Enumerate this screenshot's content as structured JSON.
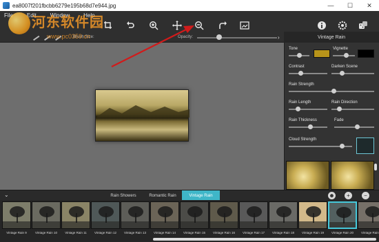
{
  "window": {
    "title": "ea8007f201fbcbb6279e195b68d7e944.jpg",
    "controls": [
      "—",
      "☐",
      "✕"
    ]
  },
  "menu": {
    "items": [
      "File",
      "Edit",
      "Window",
      "Help"
    ]
  },
  "toolbar": {
    "left_icons": [
      "open-icon",
      "save-icon",
      "crop-icon",
      "undo-icon"
    ],
    "center_icons": [
      "zoom-in-icon",
      "move-icon",
      "zoom-out-icon",
      "redo-icon",
      "fit-screen-icon"
    ],
    "right_icons": [
      "info-icon",
      "settings-icon",
      "random-icon"
    ]
  },
  "brush_bar": {
    "brush_size_label": "Brush Size:",
    "opacity_label": "Opacity:"
  },
  "panel": {
    "title": "Vintage Rain",
    "expand_arrow": "›",
    "controls": {
      "tone": "Tone",
      "vignette": "Vignette",
      "contrast": "Contrast",
      "darken_scene": "Darken Scene",
      "rain_strength": "Rain Strength",
      "rain_length": "Rain Length",
      "rain_direction": "Rain Direction",
      "rain_thickness": "Rain Thickness",
      "fade": "Fade",
      "cloud_strength": "Cloud Strength"
    },
    "colors": {
      "tone_swatch": "#b8941a",
      "vignette_swatch": "#000000"
    }
  },
  "tabs": {
    "collapse": "⌄",
    "items": [
      "Rain Showers",
      "Romantic Rain",
      "Vintage Rain"
    ],
    "active_index": 2,
    "buttons": [
      "☻",
      "+",
      "−"
    ]
  },
  "presets": {
    "items": [
      "Vintage Rain 9",
      "Vintage Rain 10",
      "Vintage Rain 11",
      "Vintage Rain 12",
      "Vintage Rain 13",
      "Vintage Rain 14",
      "Vintage Rain 15",
      "Vintage Rain 16",
      "Vintage Rain 17",
      "Vintage Rain 18",
      "Vintage Rain 19",
      "Vintage Rain 20",
      "Vintage Rain 21"
    ],
    "selected_index": 11
  },
  "watermark": {
    "text": "河东软件园",
    "url": "www.pc0359.cn"
  },
  "accent_color": "#3fb6c8"
}
